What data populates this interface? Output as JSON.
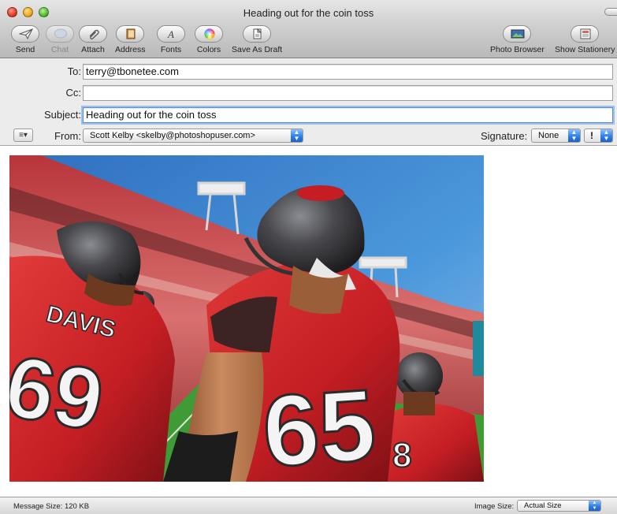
{
  "window": {
    "title": "Heading out for the coin toss"
  },
  "toolbar": {
    "send": "Send",
    "chat": "Chat",
    "attach": "Attach",
    "address": "Address",
    "fonts": "Fonts",
    "colors": "Colors",
    "save_draft": "Save As Draft",
    "photo_browser": "Photo Browser",
    "show_stationery": "Show Stationery"
  },
  "headers": {
    "to_label": "To:",
    "to_value": "terry@tbonetee.com",
    "cc_label": "Cc:",
    "cc_value": "",
    "subject_label": "Subject:",
    "subject_value": "Heading out for the coin toss",
    "from_label": "From:",
    "from_value": "Scott Kelby <skelby@photoshopuser.com>",
    "signature_label": "Signature:",
    "signature_value": "None",
    "priority_symbol": "!"
  },
  "photo": {
    "jersey_left_name": "DAVIS",
    "jersey_left_number": "69",
    "jersey_center_number": "65",
    "jersey_right_number": "8"
  },
  "status": {
    "message_size": "Message Size: 120 KB",
    "image_size_label": "Image Size:",
    "image_size_value": "Actual Size"
  },
  "colors": {
    "jersey_red": "#c41e24",
    "sky_blue": "#3f8fd6",
    "helmet": "#4a4a4e",
    "field_green": "#3f9b35",
    "accent_blue": "#2f7fe8"
  }
}
